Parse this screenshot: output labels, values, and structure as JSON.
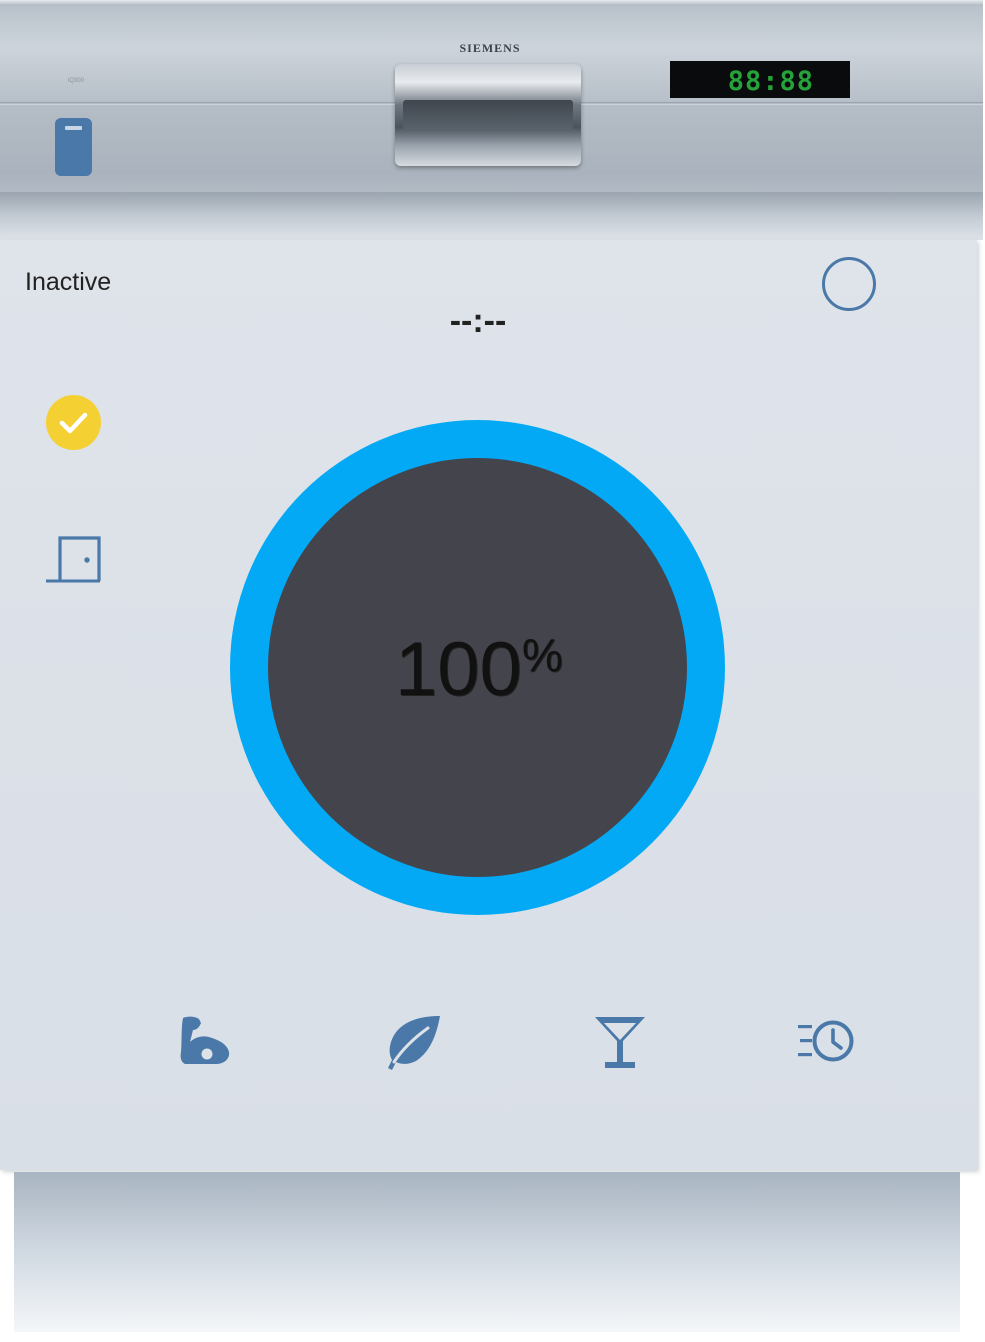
{
  "panel": {
    "brand": "SIEMENS",
    "model_label": "iQ300",
    "display_digits": "88:88"
  },
  "card": {
    "status": "Inactive",
    "remaining_time": "--:--",
    "progress_value": "100",
    "progress_unit": "%",
    "progress_percent": 100
  },
  "icons": {
    "power_button": "power-circle-icon",
    "ready": "check-circle-icon",
    "door": "door-closed-icon",
    "programs": [
      "arm-flex-icon",
      "leaf-icon",
      "glass-cocktail-icon",
      "clock-fast-icon"
    ]
  },
  "colors": {
    "accent_blue": "#03a9f4",
    "icon_blue": "#4a78a8",
    "ready_yellow": "#f5d033",
    "gauge_center": "#44444c",
    "display_green": "#28b33e"
  }
}
